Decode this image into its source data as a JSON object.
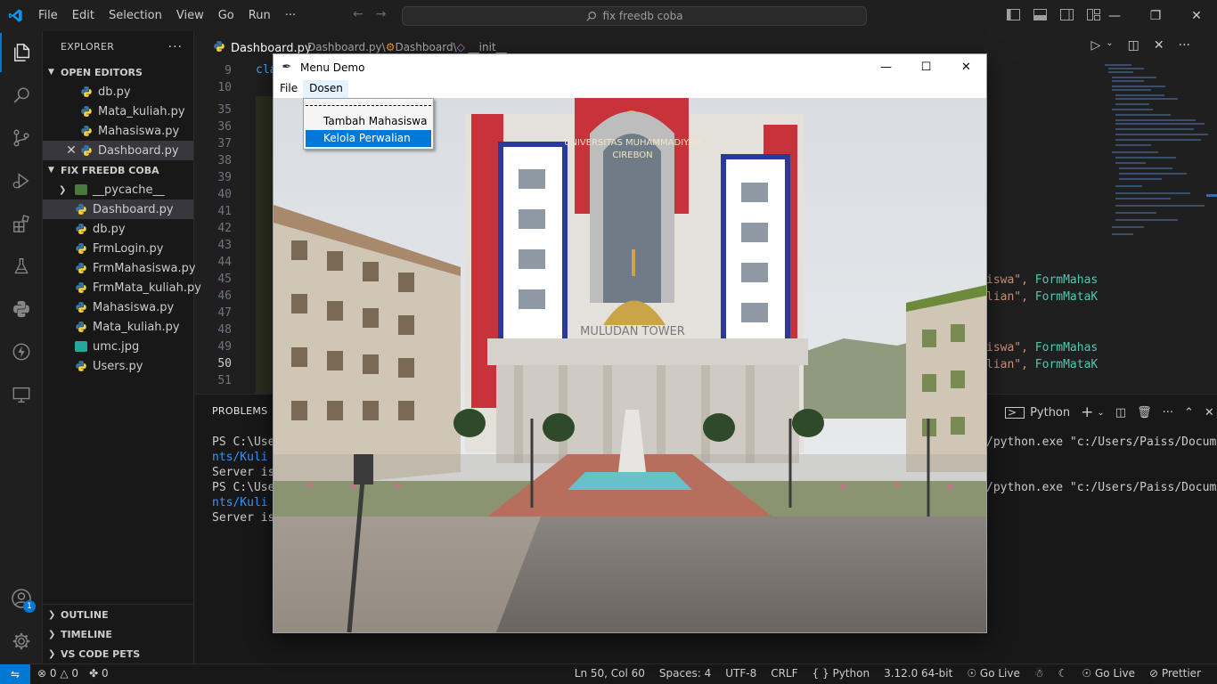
{
  "titlebar": {
    "menus": [
      "File",
      "Edit",
      "Selection",
      "View",
      "Go",
      "Run",
      "···"
    ],
    "search_text": "fix freedb coba"
  },
  "sidebar": {
    "title": "EXPLORER",
    "open_editors_label": "OPEN EDITORS",
    "open_editors": [
      {
        "name": "db.py"
      },
      {
        "name": "Mata_kuliah.py"
      },
      {
        "name": "Mahasiswa.py"
      },
      {
        "name": "Dashboard.py"
      }
    ],
    "folder_label": "FIX FREEDB COBA",
    "files": [
      {
        "name": "__pycache__",
        "kind": "folder"
      },
      {
        "name": "Dashboard.py",
        "kind": "python"
      },
      {
        "name": "db.py",
        "kind": "python"
      },
      {
        "name": "FrmLogin.py",
        "kind": "python"
      },
      {
        "name": "FrmMahasiswa.py",
        "kind": "python"
      },
      {
        "name": "FrmMata_kuliah.py",
        "kind": "python"
      },
      {
        "name": "Mahasiswa.py",
        "kind": "python"
      },
      {
        "name": "Mata_kuliah.py",
        "kind": "python"
      },
      {
        "name": "umc.jpg",
        "kind": "image"
      },
      {
        "name": "Users.py",
        "kind": "python"
      }
    ],
    "outline_label": "OUTLINE",
    "timeline_label": "TIMELINE",
    "codepets_label": "VS CODE PETS",
    "accounts_badge": "1"
  },
  "editor": {
    "tab_label": "Dashboard.py",
    "breadcrumb": {
      "file": "Dashboard.py",
      "sep": "\\",
      "cls": "Dashboard",
      "method": "__init__"
    },
    "line_numbers": [
      "9",
      "10",
      "35",
      "36",
      "37",
      "38",
      "39",
      "40",
      "41",
      "42",
      "43",
      "44",
      "45",
      "46",
      "47",
      "48",
      "49",
      "50",
      "51"
    ],
    "current_line": "50",
    "code_line9": "cla",
    "code_frag_1a": "iswa\", ",
    "code_frag_1b": "FormMahas",
    "code_frag_2a": "lian\", ",
    "code_frag_2b": "FormMataK",
    "code_frag_3a": "iswa\", ",
    "code_frag_3b": "FormMahas",
    "code_frag_4a": "lian\", ",
    "code_frag_4b": "FormMataK"
  },
  "panel": {
    "tab_label": "PROBLEMS",
    "terminal_name": "Python",
    "lines": [
      "PS C:\\User",
      "nts/Kuli a",
      "Server is",
      "PS C:\\User",
      "nts/Kuli a",
      "Server is"
    ],
    "right_line_a": "/python.exe \"c:/Users/Paiss/Docume",
    "right_line_b": "/python.exe \"c:/Users/Paiss/Docume"
  },
  "statusbar": {
    "errors": "0",
    "warnings": "0",
    "ports": "0",
    "position": "Ln 50, Col 60",
    "spaces": "Spaces: 4",
    "encoding": "UTF-8",
    "eol": "CRLF",
    "language": "Python",
    "interpreter": "3.12.0 64-bit",
    "golive1": "Go Live",
    "golive2": "Go Live",
    "prettier": "Prettier"
  },
  "tkwindow": {
    "title": "Menu Demo",
    "menus": [
      "File",
      "Dosen"
    ],
    "dropdown_items": [
      "Tambah Mahasiswa",
      "Kelola Perwalian"
    ],
    "highlighted_item": "Kelola Perwalian",
    "building_sign": "UNIVERSITAS MUHAMMADIYAH",
    "building_sign2": "CIREBON",
    "tower_sign": "MULUDAN TOWER"
  },
  "colors": {
    "accent": "#0078d4",
    "python_blue": "#3776ab",
    "python_yellow": "#ffd43b",
    "string_orange": "#ce9178",
    "class_teal": "#4ec9b0",
    "keyword_blue": "#569cd6"
  }
}
